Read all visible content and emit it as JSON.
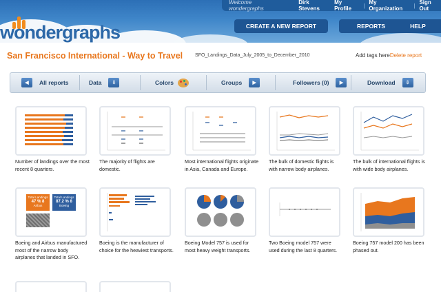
{
  "brand": {
    "logo_text": "wondergraphs"
  },
  "userbar": {
    "welcome": "Welcome wondergraphs",
    "user_name": "Dirk Stevens",
    "links": [
      "My Profile",
      "My Organization",
      "Sign Out"
    ]
  },
  "nav": {
    "create_report": "CREATE A NEW REPORT",
    "reports": "REPORTS",
    "help": "HELP"
  },
  "report": {
    "title": "San Francisco International - Way to Travel",
    "dataset": "SFO_Landings_Data_July_2005_to_December_2010",
    "add_tags": "Add tags here",
    "delete": "Delete report"
  },
  "toolbar": {
    "all_reports": "All reports",
    "data": "Data",
    "colors": "Colors",
    "groups": "Groups",
    "followers": "Followers (0)",
    "download": "Download"
  },
  "colors": {
    "brand_orange": "#e8771e",
    "brand_blue": "#2c68a8",
    "chart_blue": "#3a70b5",
    "chart_gray": "#8f8f8f"
  },
  "cards": [
    {
      "caption": "Number of landings over the most recent 8 quarters."
    },
    {
      "caption": "The majority of flights are domestic."
    },
    {
      "caption": "Most international flights originate in Asia, Canada and Europe."
    },
    {
      "caption": "The bulk of domestic flights is with narrow body airplanes."
    },
    {
      "caption": "The bulk of international flights is with wide body airplanes."
    },
    {
      "caption": "Boeing and Airbus manufactured most of the narrow body airplanes that landed in SFO.",
      "tiles": [
        {
          "label": "Total Landings",
          "value": "47 % 8",
          "sub": "Airbus"
        },
        {
          "label": "Total Landings",
          "value": "87.2 % 8",
          "sub": "Boeing"
        },
        {
          "label": "",
          "value": "",
          "sub": ""
        }
      ]
    },
    {
      "caption": "Boeing is the manufacturer of choice for the heaviest transports."
    },
    {
      "caption": "Boeing Model 757 is used for most heavy weight transports."
    },
    {
      "caption": "Two Boeing model 757 were used during the last 8 quarters."
    },
    {
      "caption": "Boeing 757 model 200 has been phased out."
    },
    {
      "caption": ""
    },
    {
      "caption": ""
    }
  ]
}
